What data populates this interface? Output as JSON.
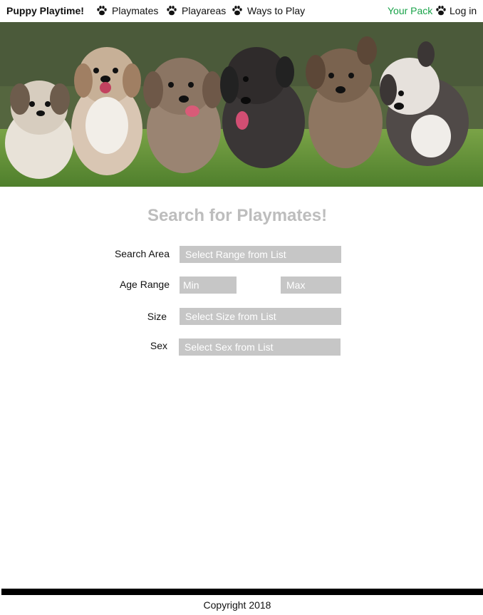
{
  "nav": {
    "brand": "Puppy Playtime!",
    "items": [
      {
        "label": "Playmates",
        "icon": "paw-icon"
      },
      {
        "label": "Playareas",
        "icon": "paw-icon"
      },
      {
        "label": "Ways to Play",
        "icon": "paw-icon"
      }
    ],
    "your_pack": "Your Pack",
    "login": "Log in",
    "accent_color": "#1aa34a"
  },
  "hero": {
    "image": "row of fluffy puppies running on grass"
  },
  "search": {
    "title": "Search for Playmates!",
    "area_label": "Search Area",
    "area_value": "Select Range from List",
    "age_label": "Age Range",
    "age_min": "Min",
    "age_max": "Max",
    "size_label": "Size",
    "size_value": "Select Size from List",
    "sex_label": "Sex",
    "sex_value": "Select Sex from List"
  },
  "footer": {
    "copyright": "Copyright 2018"
  }
}
